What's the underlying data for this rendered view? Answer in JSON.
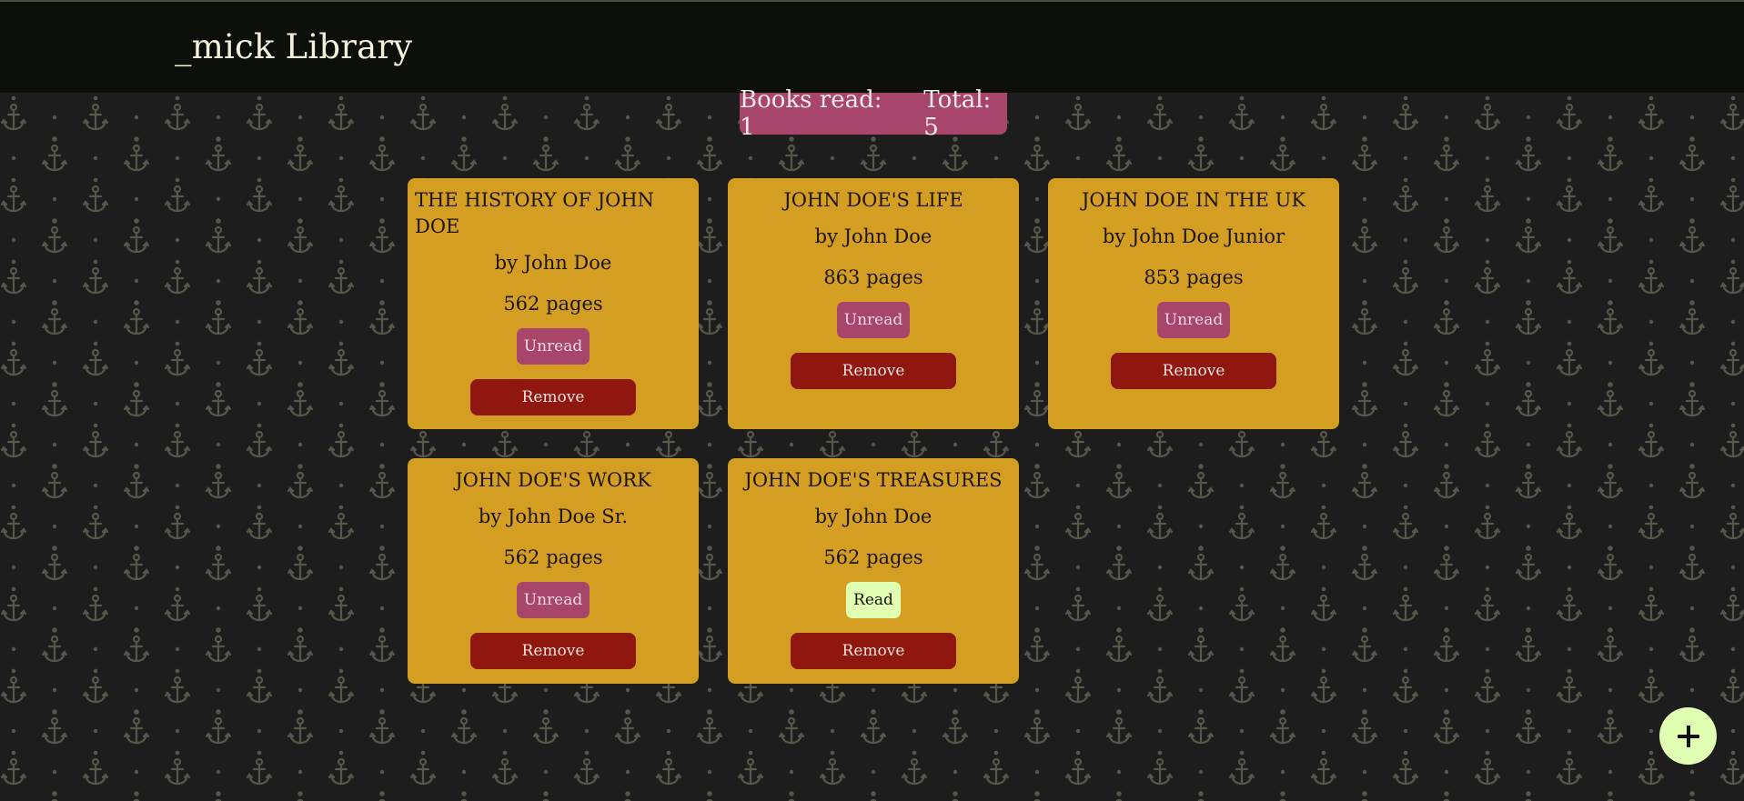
{
  "header": {
    "title": "_mick Library"
  },
  "stats": {
    "read_label": "Books read: 1",
    "total_label": "Total: 5"
  },
  "books": [
    {
      "title": "THE HISTORY OF JOHN DOE",
      "author": "by John Doe",
      "pages": "562 pages",
      "status": "Unread",
      "remove_label": "Remove"
    },
    {
      "title": "JOHN DOE'S LIFE",
      "author": "by John Doe",
      "pages": "863 pages",
      "status": "Unread",
      "remove_label": "Remove"
    },
    {
      "title": "JOHN DOE IN THE UK",
      "author": "by John Doe Junior",
      "pages": "853 pages",
      "status": "Unread",
      "remove_label": "Remove"
    },
    {
      "title": "JOHN DOE'S WORK",
      "author": "by John Doe Sr.",
      "pages": "562 pages",
      "status": "Unread",
      "remove_label": "Remove"
    },
    {
      "title": "JOHN DOE'S TREASURES",
      "author": "by John Doe",
      "pages": "562 pages",
      "status": "Read",
      "remove_label": "Remove"
    }
  ],
  "add_button": {
    "icon": "plus-icon"
  },
  "colors": {
    "header_bg": "#0d0f0b",
    "background": "#1d1d1d",
    "pattern": "#56564a",
    "card": "#d39e22",
    "unread": "#a8456a",
    "read": "#e0ffb2",
    "remove": "#8f170f"
  }
}
